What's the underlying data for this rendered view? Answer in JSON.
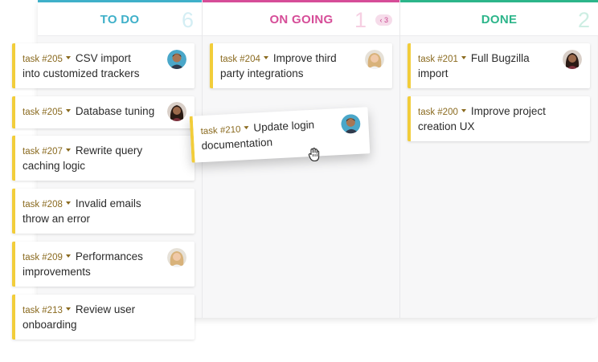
{
  "columns": [
    {
      "title": "TO DO",
      "count": "6",
      "color": "#3fb0c9",
      "count_color": "#d4eef4"
    },
    {
      "title": "ON GOING",
      "count": "1",
      "color": "#d64d98",
      "count_color": "#f6cfe2",
      "limit": "‹ 3"
    },
    {
      "title": "DONE",
      "count": "2",
      "color": "#2cb58a",
      "count_color": "#cdeee3"
    }
  ],
  "cards": {
    "todo": [
      {
        "id": "task #205",
        "title1": "CSV import",
        "title2": "into customized trackers",
        "avatar": "man-avatar"
      },
      {
        "id": "task #205",
        "title1": "Database tuning",
        "title2": "",
        "avatar": "woman-dark-avatar"
      },
      {
        "id": "task #207",
        "title1": "Rewrite query",
        "title2": "caching logic",
        "avatar": ""
      },
      {
        "id": "task #208",
        "title1": "Invalid emails",
        "title2": "throw an error",
        "avatar": ""
      },
      {
        "id": "task #209",
        "title1": "Performances",
        "title2": "improvements",
        "avatar": "woman-blonde-avatar"
      },
      {
        "id": "task #213",
        "title1": "Review user",
        "title2": "onboarding",
        "avatar": ""
      }
    ],
    "ongoing": [
      {
        "id": "task #204",
        "title1": "Improve third",
        "title2": "party integrations",
        "avatar": "woman-blonde-avatar"
      }
    ],
    "done": [
      {
        "id": "task #201",
        "title1": "Full Bugzilla",
        "title2": "import",
        "avatar": "woman-dark-avatar"
      },
      {
        "id": "task #200",
        "title1": "Improve project",
        "title2": "creation UX",
        "avatar": ""
      }
    ]
  },
  "dragging_card": {
    "id": "task #210",
    "title1": "Update login",
    "title2": "documentation",
    "avatar": "man-avatar"
  },
  "colors": {
    "card_accent": "#f2cd3a",
    "task_id": "#8a6a1f"
  }
}
